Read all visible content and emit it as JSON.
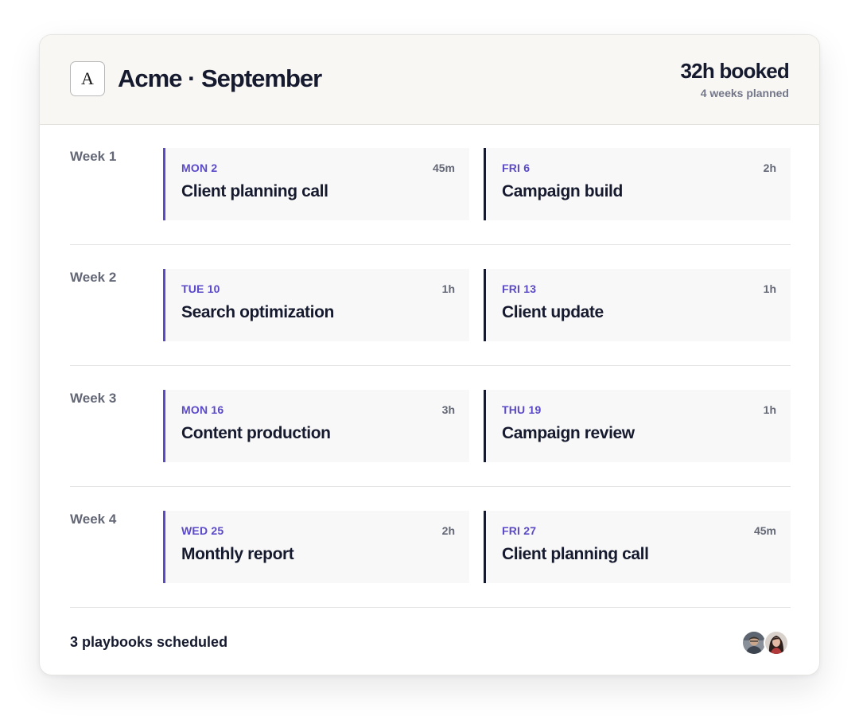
{
  "header": {
    "logo_letter": "A",
    "title": "Acme · September",
    "booked": "32h booked",
    "planned": "4 weeks planned"
  },
  "weeks": [
    {
      "label": "Week 1",
      "events": [
        {
          "date": "MON 2",
          "duration": "45m",
          "name": "Client planning call"
        },
        {
          "date": "FRI 6",
          "duration": "2h",
          "name": "Campaign build"
        }
      ]
    },
    {
      "label": "Week 2",
      "events": [
        {
          "date": "TUE 10",
          "duration": "1h",
          "name": "Search optimization"
        },
        {
          "date": "FRI 13",
          "duration": "1h",
          "name": "Client update"
        }
      ]
    },
    {
      "label": "Week 3",
      "events": [
        {
          "date": "MON 16",
          "duration": "3h",
          "name": "Content production"
        },
        {
          "date": "THU 19",
          "duration": "1h",
          "name": "Campaign review"
        }
      ]
    },
    {
      "label": "Week 4",
      "events": [
        {
          "date": "WED 25",
          "duration": "2h",
          "name": "Monthly report"
        },
        {
          "date": "FRI 27",
          "duration": "45m",
          "name": "Client planning call"
        }
      ]
    }
  ],
  "footer": {
    "summary": "3 playbooks scheduled"
  },
  "colors": {
    "accent": "#5a49c9",
    "ink": "#161a2e",
    "muted": "#646876",
    "header_bg": "#f8f7f3",
    "event_bg": "#f8f8f8"
  }
}
